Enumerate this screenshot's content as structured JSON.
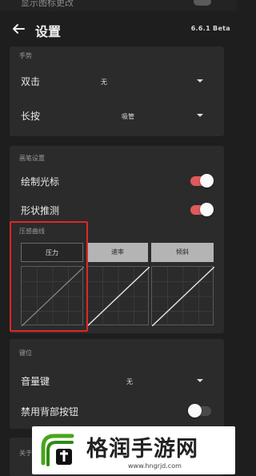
{
  "partial_top": {
    "text": "显示图标更改"
  },
  "appbar": {
    "back_icon": "arrow-left-icon",
    "title": "设置",
    "version": "6.6.1 Beta"
  },
  "gesture": {
    "section_title": "手势",
    "rows": [
      {
        "label": "双击",
        "value": "无"
      },
      {
        "label": "长按",
        "value": "吸管"
      }
    ]
  },
  "stylus": {
    "section_title": "画笔设置",
    "toggles": [
      {
        "label": "绘制光标",
        "on": true
      },
      {
        "label": "形状推测",
        "on": true
      }
    ],
    "pressure_title": "压感曲线",
    "pressure_tabs": [
      {
        "label": "压力",
        "selected": true
      },
      {
        "label": "速率",
        "selected": false
      },
      {
        "label": "倾斜",
        "selected": false
      }
    ]
  },
  "keys": {
    "section_title": "键位",
    "volume_label": "音量键",
    "volume_value": "无",
    "disable_back_label": "禁用背部按钮",
    "disable_back_on": false
  },
  "next_section": {
    "title": "关于"
  },
  "watermark": {
    "title": "格润手游网",
    "url": "www.hngrjd.com"
  },
  "colors": {
    "accent": "#e05a5a",
    "highlight": "#e02626",
    "background": "#1e1e1e",
    "card": "#2b2b2b"
  }
}
